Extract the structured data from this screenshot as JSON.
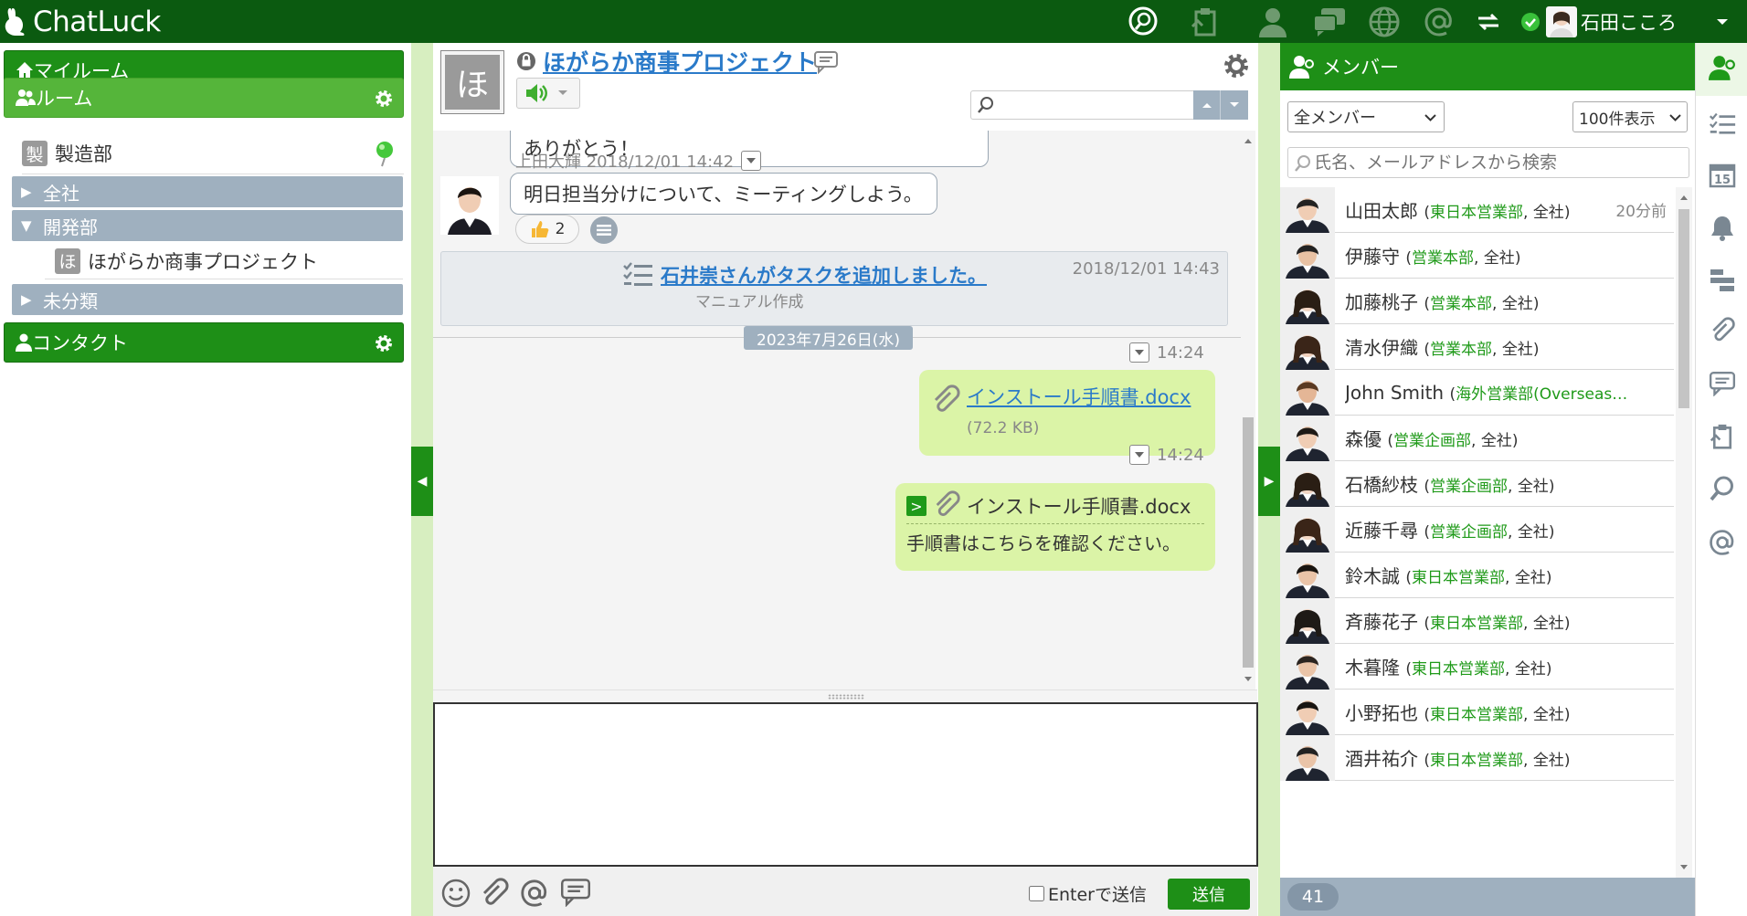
{
  "app": {
    "name": "ChatLuck"
  },
  "topbar": {
    "user_name": "石田こころ",
    "icons": [
      "chat-search-icon",
      "task-clipboard-icon",
      "person-icon",
      "chat-bubbles-icon",
      "globe-icon",
      "at-sign-icon",
      "swap-icon"
    ]
  },
  "left": {
    "myroom": "マイルーム",
    "rooms": "ルーム",
    "room_seizo": {
      "badge": "製",
      "name": "製造部"
    },
    "cat_all": "全社",
    "cat_dev": "開発部",
    "project": {
      "badge": "ほ",
      "name": "ほがらか商事プロジェクト"
    },
    "cat_uncat": "未分類",
    "contact": "コンタクト"
  },
  "chat": {
    "room_badge": "ほ",
    "room_title": "ほがらか商事プロジェクト",
    "search_placeholder": "",
    "messages": {
      "thanks": "ありがとう！",
      "ueda_meta": "上田大輝 2018/12/01 14:42",
      "ueda_text": "明日担当分けについて、ミーティングしよう。",
      "reaction_count": "2",
      "task_link": "石井崇さんがタスクを追加しました。",
      "task_time": "2018/12/01 14:43",
      "task_sub": "マニュアル作成",
      "date_divider": "2023年7月26日(水)",
      "msg1_time": "14:24",
      "file1_name": "インストール手順書.docx",
      "file1_size": "(72.2 KB)",
      "msg2_time": "14:24",
      "quote_arrow": ">",
      "file2_name": "インストール手順書.docx",
      "msg2_text": "手順書はこちらを確認ください。"
    },
    "composer": {
      "value": "",
      "enter_label": "Enterで送信",
      "send": "送信"
    }
  },
  "members": {
    "title": "メンバー",
    "filter_selected": "全メンバー",
    "per_page_selected": "100件表示",
    "search_placeholder": "氏名、メールアドレスから検索",
    "count": "41",
    "list": [
      {
        "name": "山田太郎",
        "dept": "東日本営業部",
        "scope": "全社",
        "time": "20分前"
      },
      {
        "name": "伊藤守",
        "dept": "営業本部",
        "scope": "全社",
        "time": ""
      },
      {
        "name": "加藤桃子",
        "dept": "営業本部",
        "scope": "全社",
        "time": ""
      },
      {
        "name": "清水伊織",
        "dept": "営業本部",
        "scope": "全社",
        "time": ""
      },
      {
        "name": "John Smith",
        "dept": "海外営業部(Overseas…",
        "scope": "",
        "time": ""
      },
      {
        "name": "森優",
        "dept": "営業企画部",
        "scope": "全社",
        "time": ""
      },
      {
        "name": "石橋紗枝",
        "dept": "営業企画部",
        "scope": "全社",
        "time": ""
      },
      {
        "name": "近藤千尋",
        "dept": "営業企画部",
        "scope": "全社",
        "time": ""
      },
      {
        "name": "鈴木誠",
        "dept": "東日本営業部",
        "scope": "全社",
        "time": ""
      },
      {
        "name": "斉藤花子",
        "dept": "東日本営業部",
        "scope": "全社",
        "time": ""
      },
      {
        "name": "木暮隆",
        "dept": "東日本営業部",
        "scope": "全社",
        "time": ""
      },
      {
        "name": "小野拓也",
        "dept": "東日本営業部",
        "scope": "全社",
        "time": ""
      },
      {
        "name": "酒井祐介",
        "dept": "東日本営業部",
        "scope": "全社",
        "time": ""
      }
    ]
  },
  "colors": {
    "topbar": "#0b5a10",
    "green_dark": "#1e8f17",
    "green_light": "#55b53a",
    "bubble_green": "#dbf4a7",
    "link": "#2a7ac9",
    "dept": "#1f9a19"
  }
}
